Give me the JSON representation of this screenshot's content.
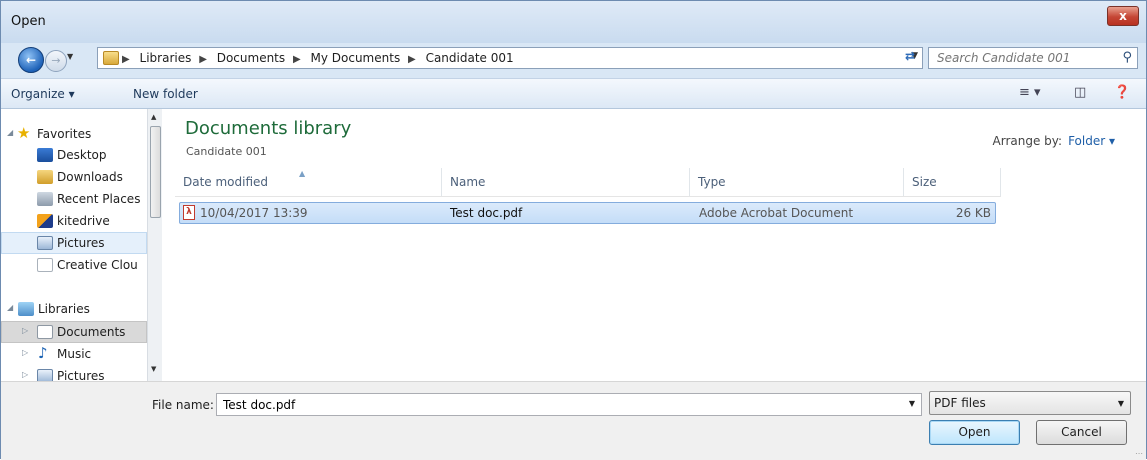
{
  "window": {
    "title": "Open",
    "close_label": "x"
  },
  "nav": {
    "breadcrumbs": [
      "Libraries",
      "Documents",
      "My Documents",
      "Candidate 001"
    ],
    "search_placeholder": "Search Candidate 001"
  },
  "toolbar": {
    "organize_label": "Organize",
    "new_folder_label": "New folder"
  },
  "sidebar": {
    "favorites_label": "Favorites",
    "favorites": [
      "Desktop",
      "Downloads",
      "Recent Places",
      "kitedrive",
      "Pictures",
      "Creative Clou"
    ],
    "libraries_label": "Libraries",
    "libraries": [
      "Documents",
      "Music",
      "Pictures"
    ],
    "selected": "Pictures"
  },
  "main": {
    "library_title": "Documents library",
    "library_subtitle": "Candidate 001",
    "arrange_label": "Arrange by:",
    "arrange_value": "Folder",
    "columns": [
      "Date modified",
      "Name",
      "Type",
      "Size"
    ],
    "files": [
      {
        "date": "10/04/2017 13:39",
        "name": "Test doc.pdf",
        "type": "Adobe Acrobat Document",
        "size": "26 KB"
      }
    ]
  },
  "footer": {
    "filename_label": "File name:",
    "filename_value": "Test doc.pdf",
    "filetype_value": "PDF files",
    "open_label": "Open",
    "cancel_label": "Cancel"
  }
}
